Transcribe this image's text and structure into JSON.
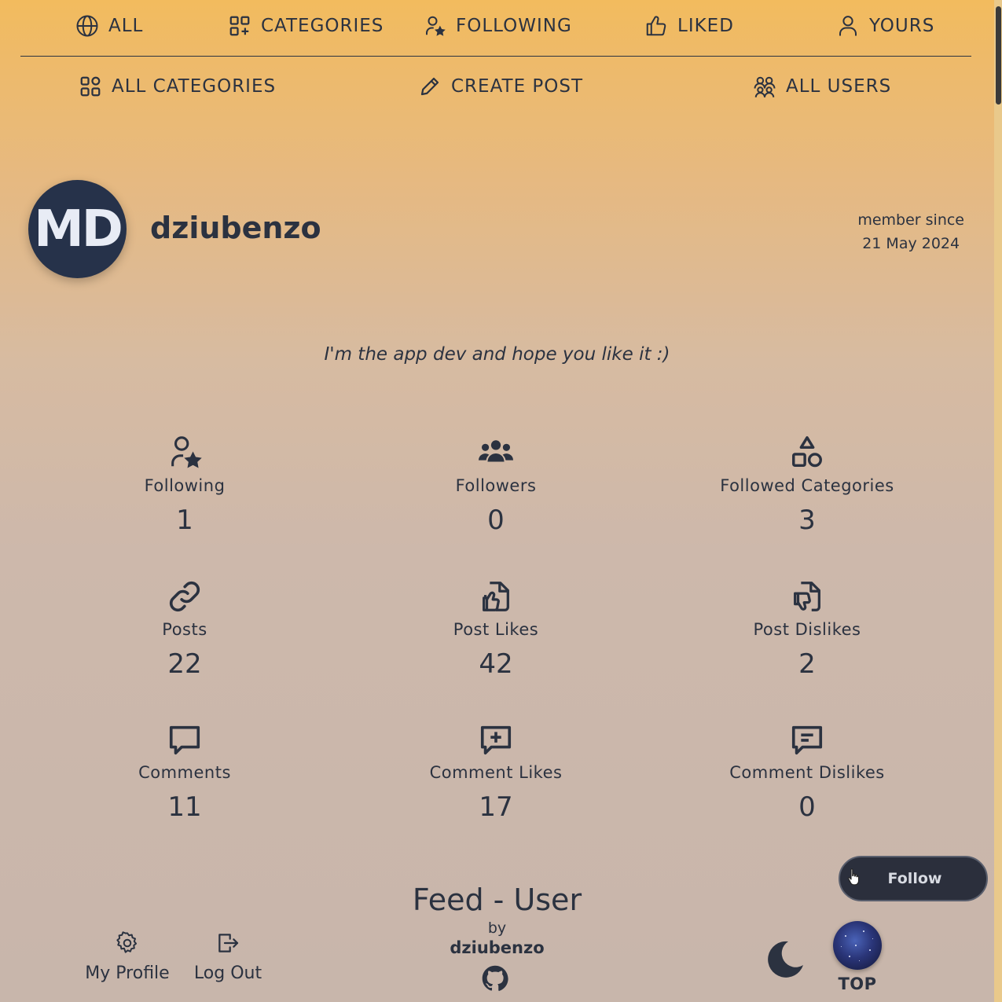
{
  "nav": {
    "top": [
      {
        "label": "ALL",
        "icon": "globe-icon"
      },
      {
        "label": "CATEGORIES",
        "icon": "category-plus-icon"
      },
      {
        "label": "FOLLOWING",
        "icon": "user-star-icon"
      },
      {
        "label": "LIKED",
        "icon": "thumbs-up-icon"
      },
      {
        "label": "YOURS",
        "icon": "user-icon"
      }
    ],
    "sub": [
      {
        "label": "ALL CATEGORIES",
        "icon": "grid-icon"
      },
      {
        "label": "CREATE POST",
        "icon": "pencil-icon"
      },
      {
        "label": "ALL USERS",
        "icon": "users-icon"
      }
    ]
  },
  "profile": {
    "initials": "MD",
    "username": "dziubenzo",
    "member_since_label": "member since",
    "member_since_date": "21 May 2024",
    "bio": "I'm the app dev and hope you like it :)"
  },
  "stats": [
    {
      "label": "Following",
      "value": "1",
      "icon": "user-star-icon"
    },
    {
      "label": "Followers",
      "value": "0",
      "icon": "people-group-icon"
    },
    {
      "label": "Followed Categories",
      "value": "3",
      "icon": "shapes-icon"
    },
    {
      "label": "Posts",
      "value": "22",
      "icon": "link-icon"
    },
    {
      "label": "Post Likes",
      "value": "42",
      "icon": "file-like-icon"
    },
    {
      "label": "Post Dislikes",
      "value": "2",
      "icon": "file-dislike-icon"
    },
    {
      "label": "Comments",
      "value": "11",
      "icon": "comment-icon"
    },
    {
      "label": "Comment Likes",
      "value": "17",
      "icon": "comment-plus-icon"
    },
    {
      "label": "Comment Dislikes",
      "value": "0",
      "icon": "comment-minus-icon"
    }
  ],
  "follow_button": {
    "label": "Follow"
  },
  "footer": {
    "title": "Feed - User",
    "by": "by",
    "author": "dziubenzo",
    "my_profile": "My Profile",
    "log_out": "Log Out",
    "top": "TOP"
  },
  "colors": {
    "text": "#2b3240",
    "avatar_bg": "#26324a",
    "button_bg": "#2b2f3c",
    "gradient_top": "#f2bb5e",
    "gradient_bottom": "#c8b6ab"
  }
}
